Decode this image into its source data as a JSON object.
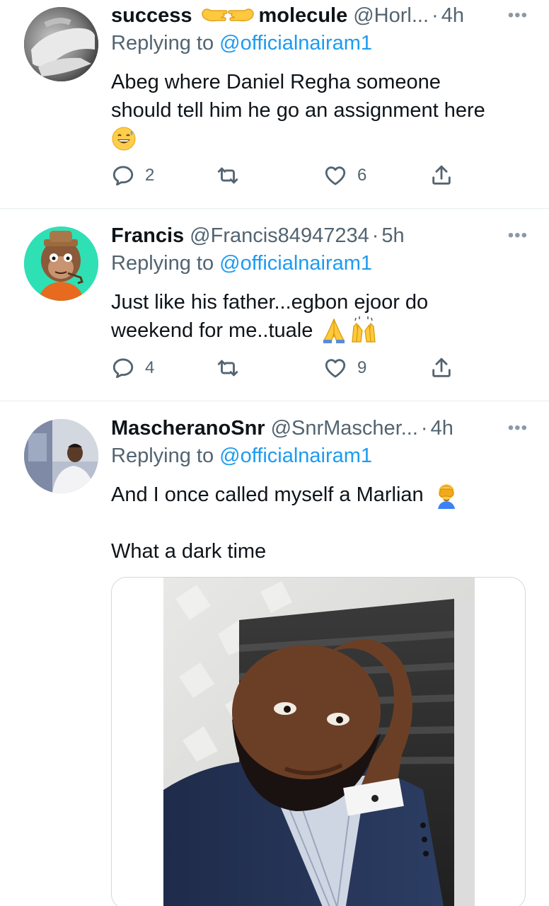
{
  "tweets": [
    {
      "name": "success",
      "name2": "molecule",
      "handle": "@Horl...",
      "dot": "·",
      "time": "4h",
      "more": "•••",
      "replying_label": "Replying to",
      "replying_mention": "@officialnairam1",
      "text_lines": [
        "Abeg where Daniel Regha someone",
        "should tell him he go an assignment here"
      ],
      "emoji_name": "grinning-sweat-emoji",
      "reply_count": "2",
      "retweet_count": "",
      "like_count": "6"
    },
    {
      "name": "Francis",
      "handle": "@Francis84947234",
      "dot": "·",
      "time": "5h",
      "more": "•••",
      "replying_label": "Replying to",
      "replying_mention": "@officialnairam1",
      "text_lines": [
        "Just like his father...egbon ejoor do",
        "weekend for me..tuale"
      ],
      "reply_count": "4",
      "retweet_count": "",
      "like_count": "9"
    },
    {
      "name": "MascheranoSnr",
      "handle": "@SnrMascher...",
      "dot": "·",
      "time": "4h",
      "more": "•••",
      "replying_label": "Replying to",
      "replying_mention": "@officialnairam1",
      "text_line1": "And I once called myself a Marlian",
      "text_line2": "What a dark time"
    }
  ],
  "icons": {
    "reply": "reply-icon",
    "retweet": "retweet-icon",
    "like": "like-icon",
    "share": "share-icon"
  },
  "colors": {
    "link": "#1d9bf0",
    "secondary_text": "#536471",
    "divider": "#e6ecf0"
  }
}
